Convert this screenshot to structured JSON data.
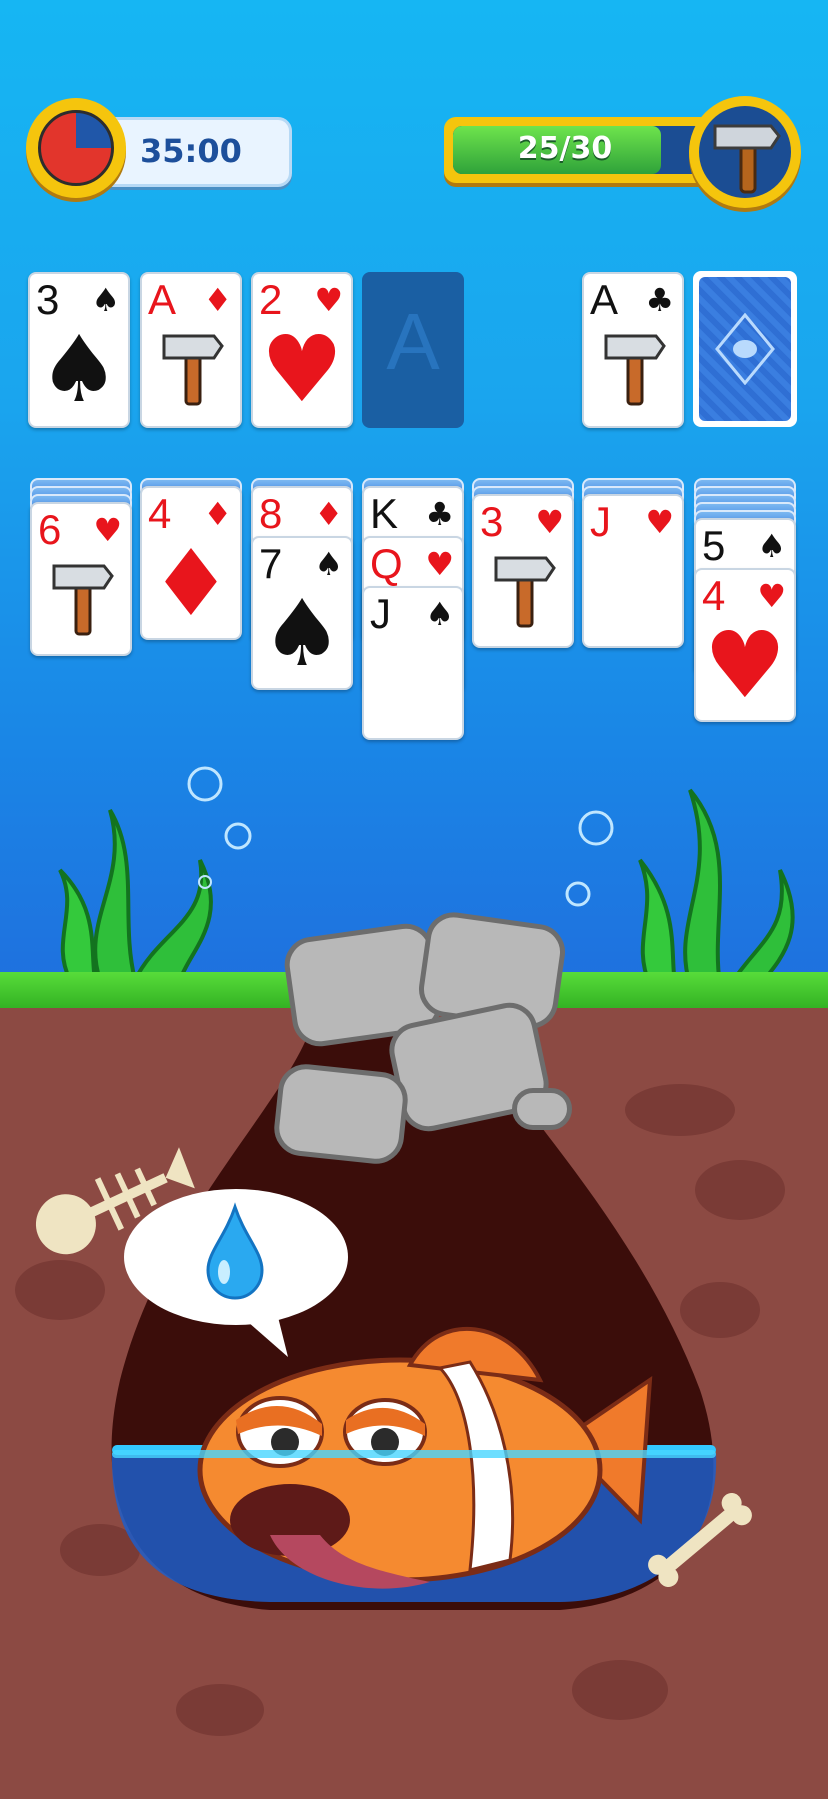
{
  "hud": {
    "timer": "35:00",
    "timer_fraction_remaining": 0.75,
    "moves_progress": "25/30",
    "moves_fraction": 0.8333
  },
  "foundation": [
    {
      "rank": "3",
      "suit": "♠",
      "color": "black",
      "center": "♠"
    },
    {
      "rank": "A",
      "suit": "♦",
      "color": "red",
      "center": "hammer"
    },
    {
      "rank": "2",
      "suit": "♥",
      "color": "red",
      "center": "♥"
    },
    {
      "rank": "A",
      "suit": "",
      "color": "empty",
      "center": ""
    }
  ],
  "waste": {
    "rank": "A",
    "suit": "♣",
    "color": "black",
    "center": "hammer"
  },
  "tableau": [
    {
      "hidden": 3,
      "cards": [
        {
          "rank": "6",
          "suit": "♥",
          "color": "red"
        }
      ]
    },
    {
      "hidden": 1,
      "cards": [
        {
          "rank": "4",
          "suit": "♦",
          "color": "red"
        }
      ]
    },
    {
      "hidden": 1,
      "cards": [
        {
          "rank": "8",
          "suit": "♦",
          "color": "red"
        },
        {
          "rank": "7",
          "suit": "♠",
          "color": "black"
        }
      ]
    },
    {
      "hidden": 1,
      "cards": [
        {
          "rank": "K",
          "suit": "♣",
          "color": "black"
        },
        {
          "rank": "Q",
          "suit": "♥",
          "color": "red"
        },
        {
          "rank": "J",
          "suit": "♠",
          "color": "black"
        }
      ]
    },
    {
      "hidden": 2,
      "cards": [
        {
          "rank": "3",
          "suit": "♥",
          "color": "red"
        }
      ]
    },
    {
      "hidden": 2,
      "cards": [
        {
          "rank": "J",
          "suit": "♥",
          "color": "red"
        }
      ]
    },
    {
      "hidden": 5,
      "cards": [
        {
          "rank": "5",
          "suit": "♠",
          "color": "black"
        },
        {
          "rank": "4",
          "suit": "♥",
          "color": "red"
        }
      ]
    }
  ],
  "icons": {
    "timer": "clock-icon",
    "booster": "hammer-icon",
    "stock": "fish-card-back-icon",
    "thought": "water-drop-icon"
  },
  "colors": {
    "water": "#1aa5ee",
    "grass": "#3dc42a",
    "dirt": "#8c4a43",
    "hole": "#3b0d0a",
    "red_suit": "#e8151c"
  }
}
